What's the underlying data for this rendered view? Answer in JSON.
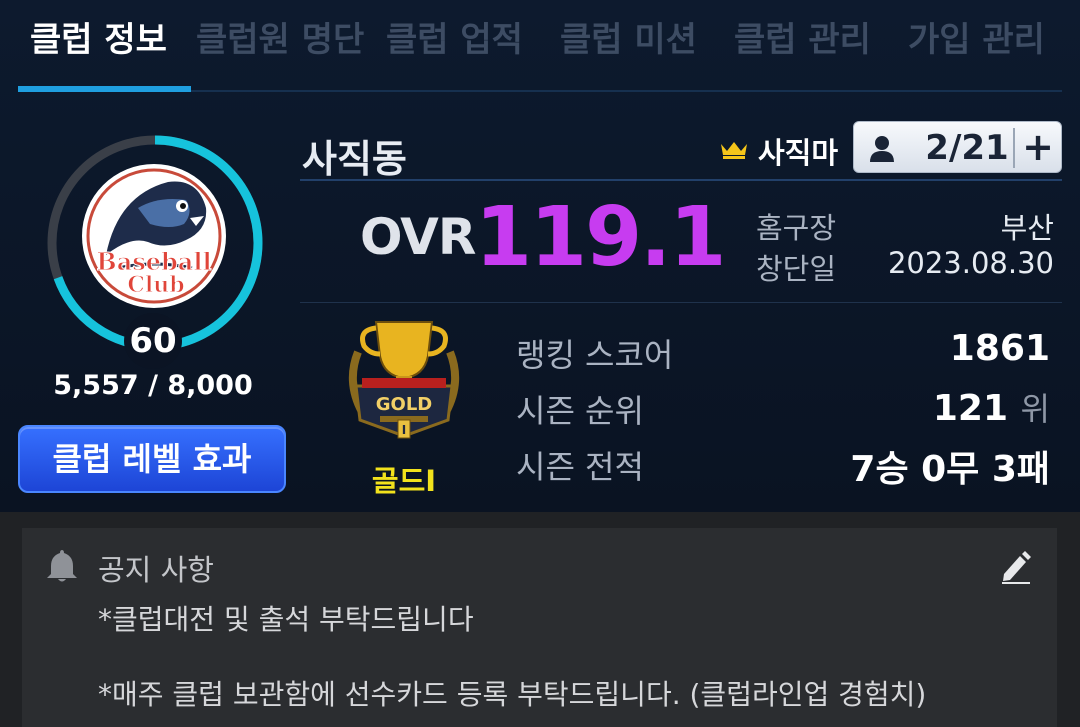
{
  "tabs": [
    {
      "label": "클럽 정보",
      "active": true
    },
    {
      "label": "클럽원 명단",
      "active": false
    },
    {
      "label": "클럽 업적",
      "active": false
    },
    {
      "label": "클럽 미션",
      "active": false
    },
    {
      "label": "클럽 관리",
      "active": false
    },
    {
      "label": "가입 관리",
      "active": false
    }
  ],
  "club": {
    "logo_text_line1": "Baseball",
    "logo_text_line2": "Club",
    "level": "60",
    "exp_text": "5,557 / 8,000",
    "exp_fraction": 0.695,
    "level_button": "클럽 레벨 효과",
    "name": "사직동",
    "master": "사직마",
    "members": "2/21",
    "add_button": "+",
    "ovr_label": "OVR",
    "ovr_value": "119.1",
    "home_label": "홈구장",
    "home_value": "부산",
    "founded_label": "창단일",
    "founded_value": "2023.08.30"
  },
  "tier": {
    "name": "골드I",
    "emblem_text": "GOLD",
    "emblem_roman": "I"
  },
  "stats": {
    "ranking_label": "랭킹 스코어",
    "ranking_value": "1861",
    "season_rank_label": "시즌 순위",
    "season_rank_value": "121",
    "season_rank_unit": "위",
    "record_label": "시즌 전적",
    "record_value": "7승 0무 3패"
  },
  "notice": {
    "title": "공지 사항",
    "lines": [
      "*클럽대전 및 출석 부탁드립니다",
      "*매주 클럽 보관함에 선수카드 등록 부탁드립니다. (클럽라인업 경험치)"
    ]
  },
  "colors": {
    "accent_blue": "#1f9fe0",
    "ovr_purple": "#c73cf0",
    "tier_gold": "#f2e21c",
    "button_blue": "#2a5cf0"
  },
  "icons": [
    "crown-icon",
    "member-icon",
    "plus-icon",
    "bell-icon",
    "edit-icon"
  ]
}
